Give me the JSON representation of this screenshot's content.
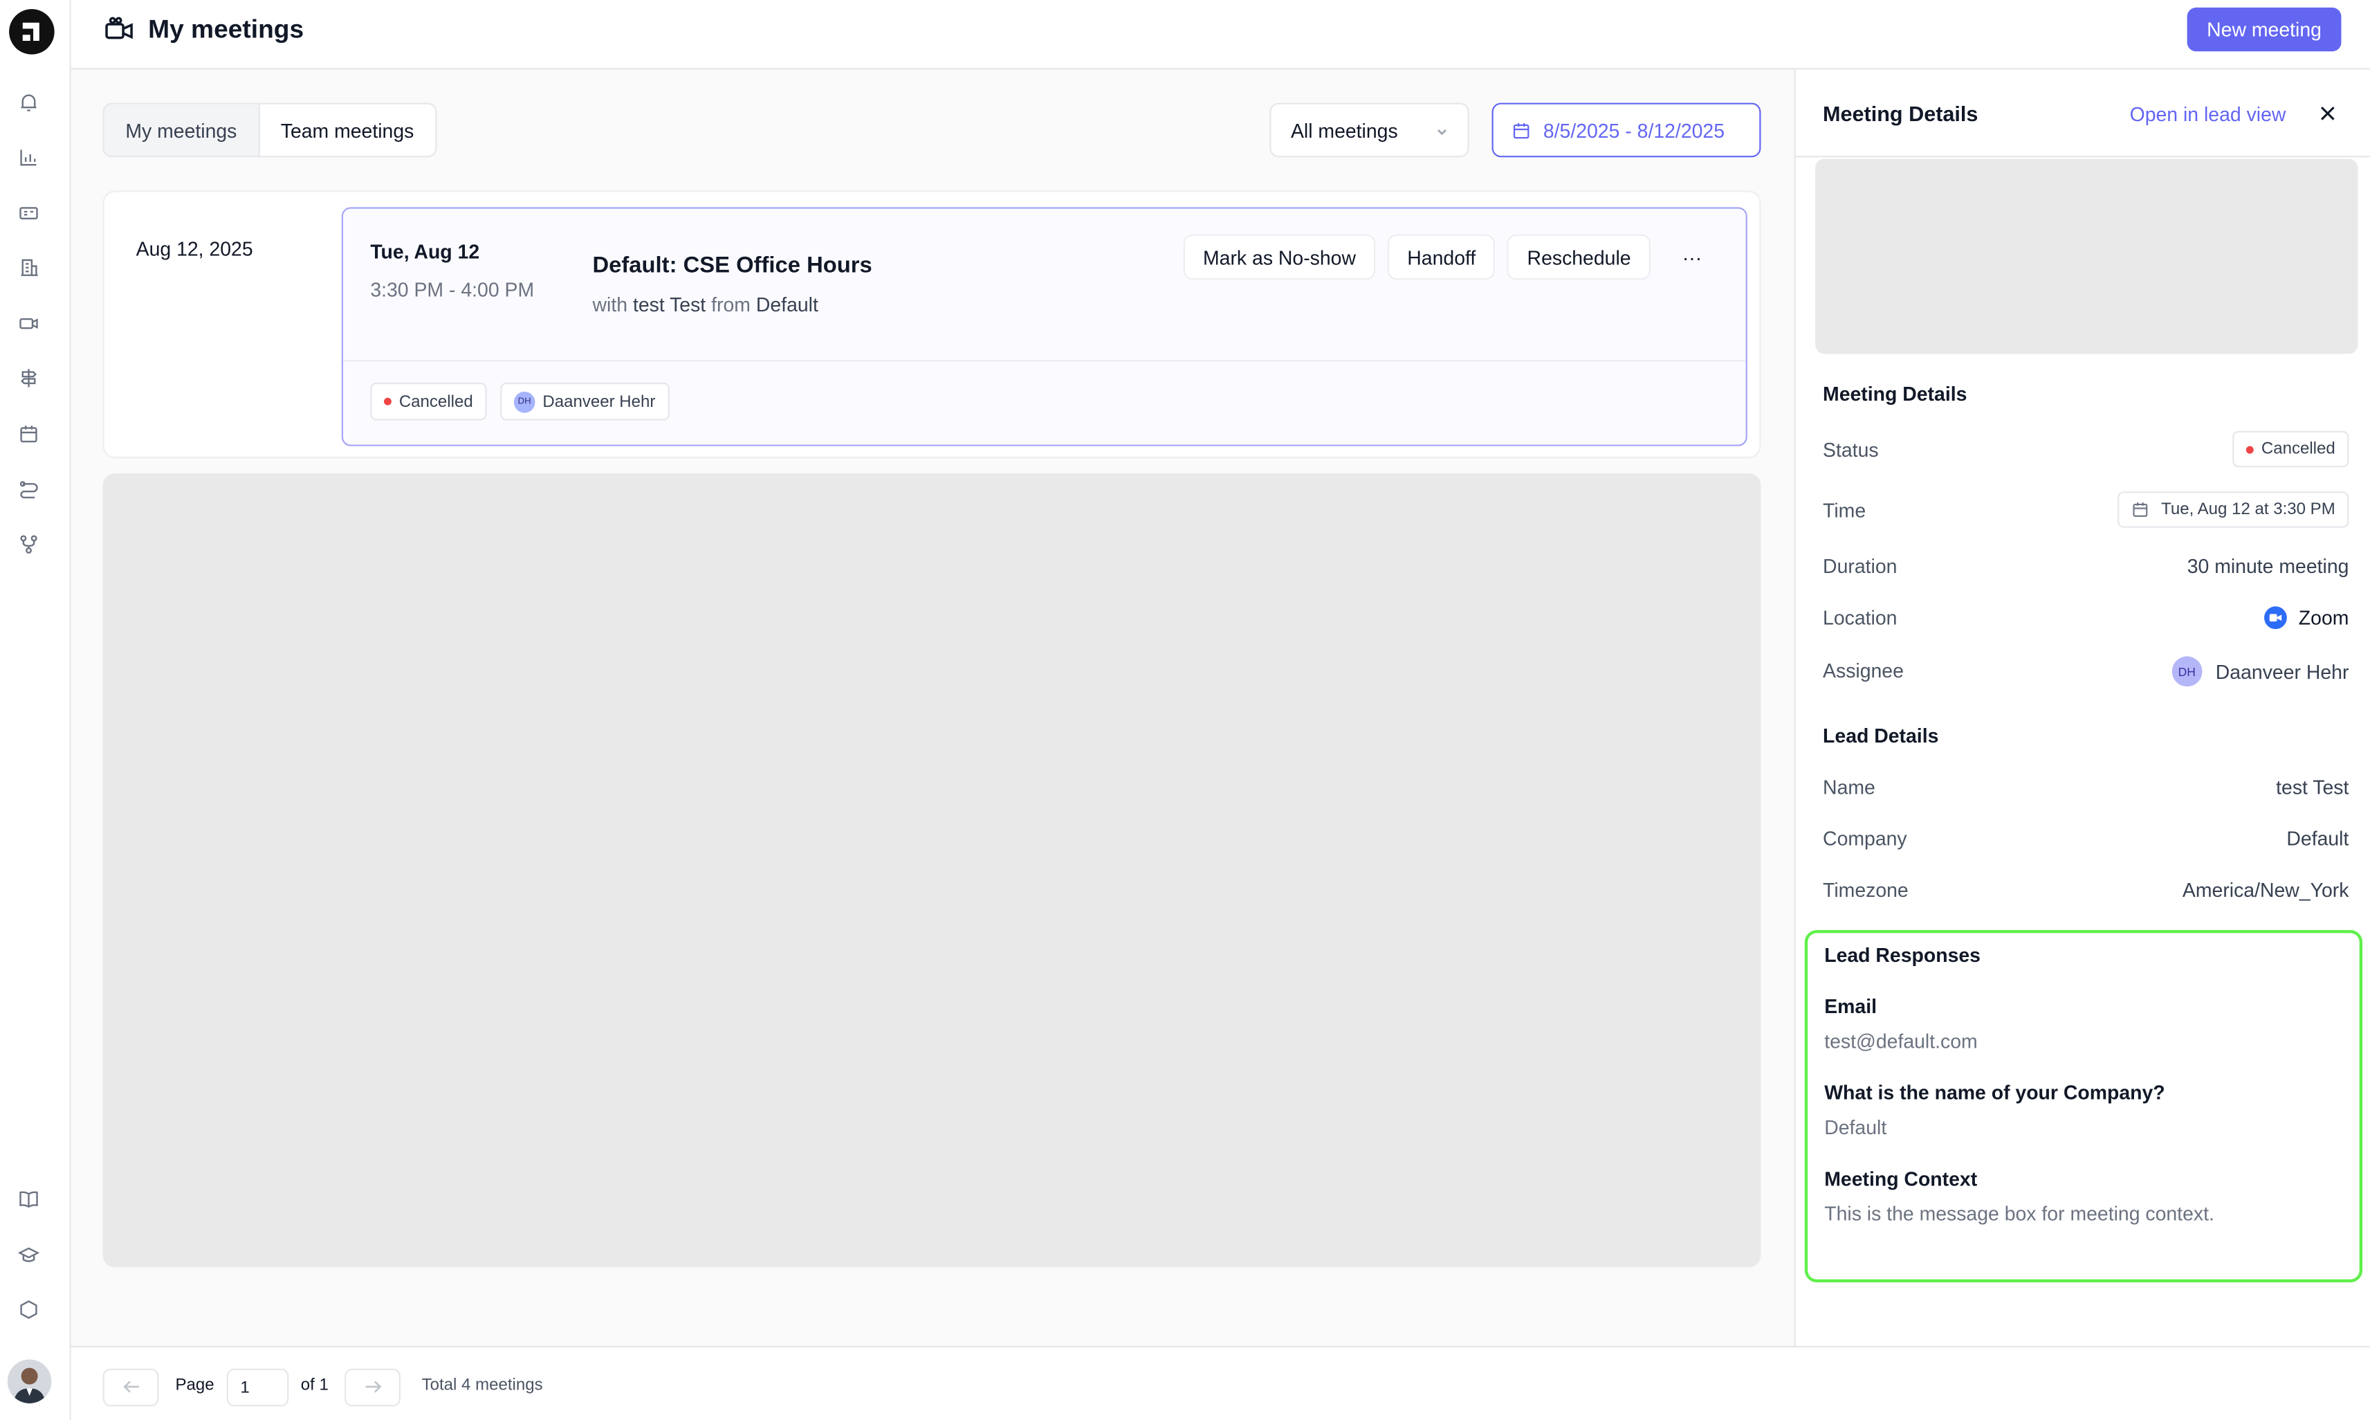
{
  "header": {
    "title": "My meetings",
    "new_meeting_label": "New meeting"
  },
  "tabs": [
    {
      "label": "My meetings",
      "active": true
    },
    {
      "label": "Team meetings",
      "active": false
    }
  ],
  "filter": {
    "selected": "All meetings"
  },
  "date_range": "8/5/2025 - 8/12/2025",
  "day_group": {
    "date_label": "Aug 12, 2025",
    "meeting": {
      "day": "Tue, Aug 12",
      "time": "3:30 PM - 4:00 PM",
      "title": "Default: CSE Office Hours",
      "with_prefix": "with",
      "lead_name": "test Test",
      "from_prefix": "from",
      "company": "Default",
      "actions": [
        "Mark as No-show",
        "Handoff",
        "Reschedule",
        "···"
      ],
      "status": "Cancelled",
      "assignee_initials": "DH",
      "assignee": "Daanveer Hehr"
    }
  },
  "pager": {
    "page_label": "Page",
    "page_value": "1",
    "of_label": "of 1",
    "total": "Total 4 meetings"
  },
  "panel": {
    "title": "Meeting Details",
    "open_lead": "Open in lead view",
    "meeting_section": "Meeting Details",
    "rows": {
      "status_label": "Status",
      "status_value": "Cancelled",
      "time_label": "Time",
      "time_value": "Tue, Aug 12 at 3:30 PM",
      "duration_label": "Duration",
      "duration_value": "30 minute meeting",
      "location_label": "Location",
      "location_value": "Zoom",
      "assignee_label": "Assignee",
      "assignee_initials": "DH",
      "assignee_value": "Daanveer Hehr"
    },
    "lead_section": "Lead Details",
    "lead": {
      "name_label": "Name",
      "name_value": "test Test",
      "company_label": "Company",
      "company_value": "Default",
      "timezone_label": "Timezone",
      "timezone_value": "America/New_York"
    },
    "responses_section": "Lead Responses",
    "responses": [
      {
        "q": "Email",
        "a": "test@default.com"
      },
      {
        "q": "What is the name of your Company?",
        "a": "Default"
      },
      {
        "q": "Meeting Context",
        "a": "This is the message box for meeting context."
      }
    ]
  },
  "colors": {
    "accent": "#6366f1",
    "status_cancelled": "#ef4444",
    "highlight_border": "#5ff04a",
    "zoom": "#2d6cf6"
  },
  "icons": [
    "app-logo-icon",
    "bell-icon",
    "chart-icon",
    "id-card-icon",
    "building-icon",
    "video-icon",
    "signpost-icon",
    "calendar-icon",
    "route-icon",
    "branch-icon",
    "book-icon",
    "graduation-cap-icon",
    "hexagon-icon",
    "chevron-down-icon",
    "close-icon",
    "arrow-left-icon",
    "arrow-right-icon"
  ]
}
